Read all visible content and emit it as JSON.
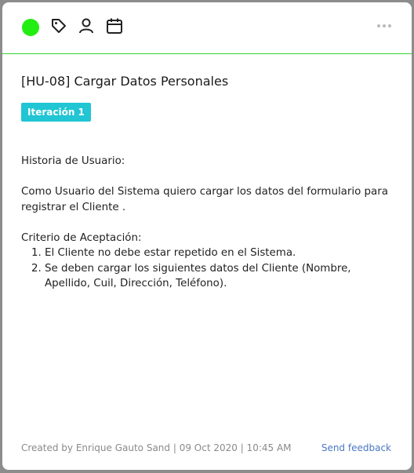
{
  "toolbar": {
    "status_color": "#22ee11",
    "icons": [
      "tag-icon",
      "person-icon",
      "calendar-icon",
      "more-icon"
    ]
  },
  "card": {
    "title": "[HU-08] Cargar Datos Personales",
    "iteration_badge": "Iteración 1",
    "story_heading": "Historia de Usuario:",
    "story_text": "Como Usuario del Sistema quiero cargar los datos del formulario para registrar el Cliente .",
    "criteria_heading": "Criterio de Aceptación:",
    "criteria": [
      "El Cliente no debe estar repetido en el Sistema.",
      "Se deben cargar los siguientes datos del Cliente (Nombre, Apellido, Cuil, Dirección, Teléfono)."
    ]
  },
  "footer": {
    "created_info": "Created by Enrique Gauto Sand | 09 Oct 2020 | 10:45 AM",
    "feedback_link": "Send feedback"
  }
}
